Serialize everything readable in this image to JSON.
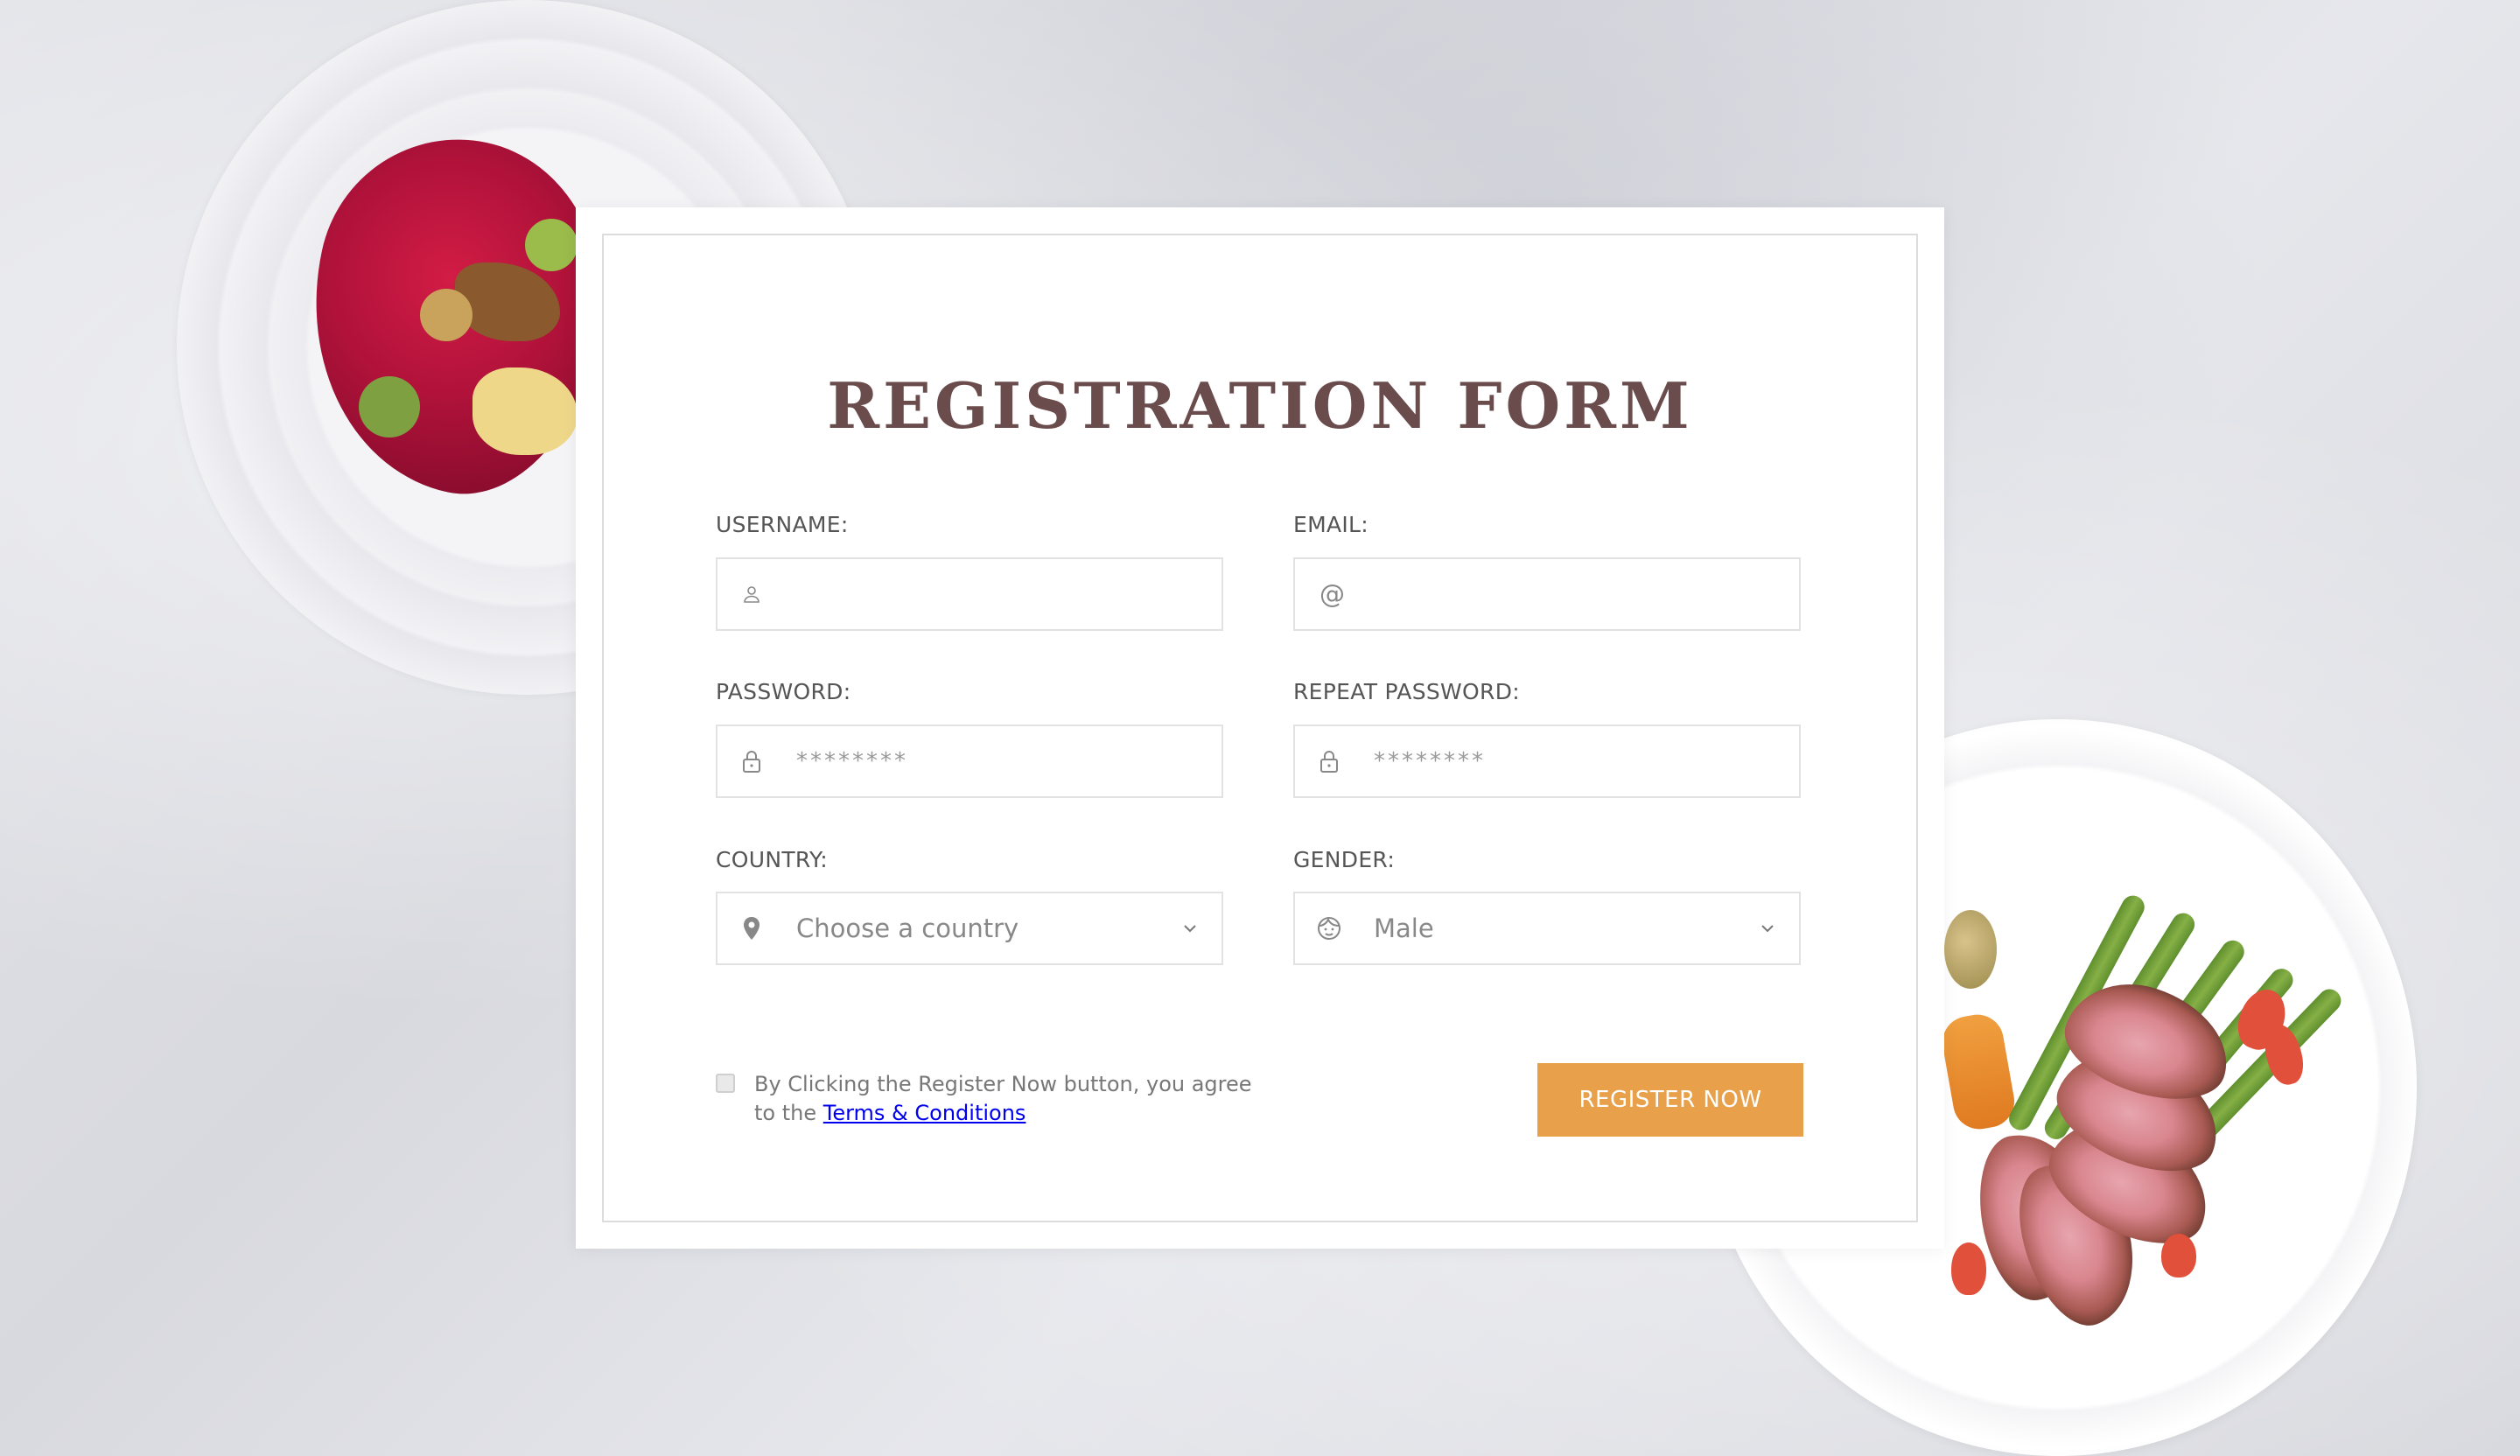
{
  "form": {
    "title": "REGISTRATION FORM",
    "username": {
      "label": "USERNAME:",
      "value": "",
      "icon": "user-icon"
    },
    "email": {
      "label": "EMAIL:",
      "value": "@",
      "icon": "at-sign"
    },
    "password": {
      "label": "PASSWORD:",
      "value": "********",
      "icon": "lock-icon"
    },
    "repeat_password": {
      "label": "REPEAT PASSWORD:",
      "value": "********",
      "icon": "lock-icon"
    },
    "country": {
      "label": "COUNTRY:",
      "selected": "Choose a country",
      "icon": "map-pin-icon"
    },
    "gender": {
      "label": "GENDER:",
      "selected": "Male",
      "icon": "face-icon"
    },
    "terms": {
      "text": "By Clicking the Register Now button, you agree to the",
      "link_text": "Terms & Conditions",
      "checked": false
    },
    "submit_label": "REGISTER NOW"
  },
  "colors": {
    "title": "#6b4c4c",
    "button": "#e8a04a",
    "link": "#0000ee",
    "label": "#555555",
    "border": "#e2e2e2"
  }
}
